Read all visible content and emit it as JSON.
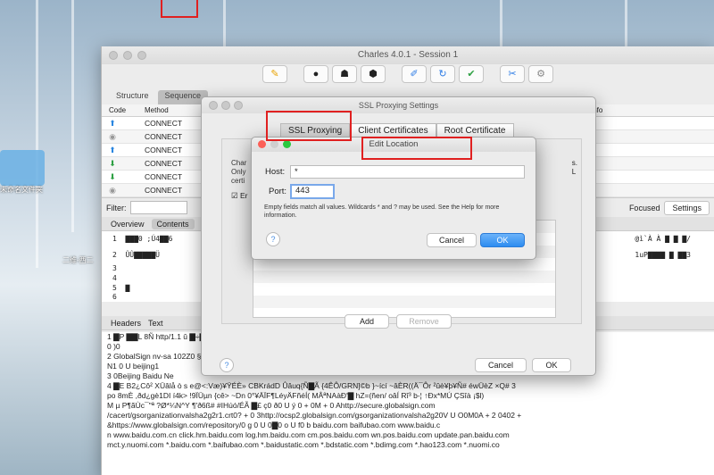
{
  "desktop": {
    "folder_label": "未命名文件夹",
    "item_label": "二维-西二"
  },
  "main_window": {
    "title": "Charles 4.0.1 - Session 1",
    "toolbar_icons": [
      "pen-icon",
      "record-icon",
      "turtle-icon",
      "stop-icon",
      "edit-icon",
      "refresh-icon",
      "check-icon",
      "tools-icon",
      "settings-icon"
    ],
    "tabs": [
      "Structure",
      "Sequence"
    ],
    "columns": [
      "Code",
      "Method",
      "Info"
    ],
    "rows": [
      {
        "icon": "up-arrow-icon",
        "method": "CONNECT"
      },
      {
        "icon": "lock-icon",
        "method": "CONNECT"
      },
      {
        "icon": "up-arrow-icon",
        "method": "CONNECT"
      },
      {
        "icon": "down-arrow-icon",
        "method": "CONNECT"
      },
      {
        "icon": "down-arrow-icon",
        "method": "CONNECT"
      },
      {
        "icon": "lock-icon",
        "method": "CONNECT"
      }
    ],
    "filter_label": "Filter:",
    "focused_label": "Focused",
    "settings_button": "Settings",
    "detail_tabs": [
      "Overview",
      "Contents"
    ],
    "hex_rows": [
      {
        "num": "1",
        "left": "▇▇▇0  ;Ú4▇▇6",
        "right": "@ì`À À ▇ ▇ ▇/"
      },
      {
        "num": "2",
        "left": "ÛÛ▇▇▇▇▇Ü",
        "right": "1uP▇▇▇▇ ▇ ▇▇3"
      },
      {
        "num": "3",
        "left": "",
        "right": ""
      },
      {
        "num": "4",
        "left": "",
        "right": ""
      },
      {
        "num": "5",
        "left": "▇",
        "right": ""
      },
      {
        "num": "6",
        "left": "",
        "right": ""
      }
    ],
    "text_tabs": [
      "Headers",
      "Text"
    ],
    "text_lines": [
      "1   ▇P ▇▇L  8Ñ                                                                                                      http/1.1  û ▇÷▇6",
      "            0    )0                                                                                                                        ",
      "2   GlobalSign nv-sa                                                                                                  102Z0  §1 0    U  C",
      "    N1 0   U  beijing1                                                                                                                      ",
      "3   0Beijing Baidu Ne                                                                                                                       ",
      "4   ▇E   B2¿Cô² XÜâlå  ò s  e@<:Væ)¥ŸÉÈ»   CBKrádD Ûâuq{Ñ▇Ã {4ÊÔ/GRN]©b }~ící  ~âÈR((Ä¯Ôr ²ûè¥þ¥Ñ#  éwÜèZ  ×Q# 3",
      "po  8mÈ  ,ðd¿gè1DI  í4k> !9ÏÜµn  {cê> ~Dn 0°¥ÄÏF¶LéyÄFñéÍ(            MÂªNAàÐ'▇   hZ=(ñen/ oâÍ  Rî³   b-¦  ↑Ðx*MÚ   ÇSîà   ¡$l)",
      "M µ P¶ãÙc¯\"ª     ?Ø*¼N^Y  ¶'ð6ß#  #IHúó/ÉÃ ▇£   ç0   ð0 U ý   0   +      0M + 0  Ahttp://secure.globalsign.com",
      "   /cacert/gsorganizationvalsha2g2r1.crt0?  +  0  3http://ocsp2.globalsign.com/gsorganizationvalsha2g20V  U  O0M0A  +  2 0402 +",
      "   &https://www.globalsign.com/repository/0 g   0    U  0▇0  o U   f0  b               baidu.com  baifubao.com   www.baidu.c",
      "n   www.baidu.com.cn   click.hm.baidu.com    log.hm.baidu.com    cm.pos.baidu.com    wn.pos.baidu.com    update.pan.baidu.com",
      "mct.y.nuomi.com   *.baidu.com   *.baifubao.com   *.baidustatic.com   *.bdstatic.com   *.bdimg.com   *.hao123.com   *.nuomi.co"
    ]
  },
  "ssl_window": {
    "title": "SSL Proxying Settings",
    "tabs": [
      "SSL Proxying",
      "Client Certificates",
      "Root Certificate"
    ],
    "desc_left": [
      "Char",
      "Only",
      "certi"
    ],
    "desc_right": [
      "s.",
      "L"
    ],
    "enable_label": "Er",
    "add_button": "Add",
    "remove_button": "Remove",
    "cancel_button": "Cancel",
    "ok_button": "OK"
  },
  "edit_dialog": {
    "title": "Edit Location",
    "host_label": "Host:",
    "host_value": "*",
    "port_label": "Port:",
    "port_value": "443",
    "hint": "Empty fields match all values. Wildcards * and ? may be used. See the Help for more information.",
    "cancel_button": "Cancel",
    "ok_button": "OK"
  },
  "colors": {
    "primary_button": "#2d8cf0",
    "annotation_red": "#e02020",
    "close_red": "#fc5f57",
    "zoom_green": "#2ac840"
  }
}
